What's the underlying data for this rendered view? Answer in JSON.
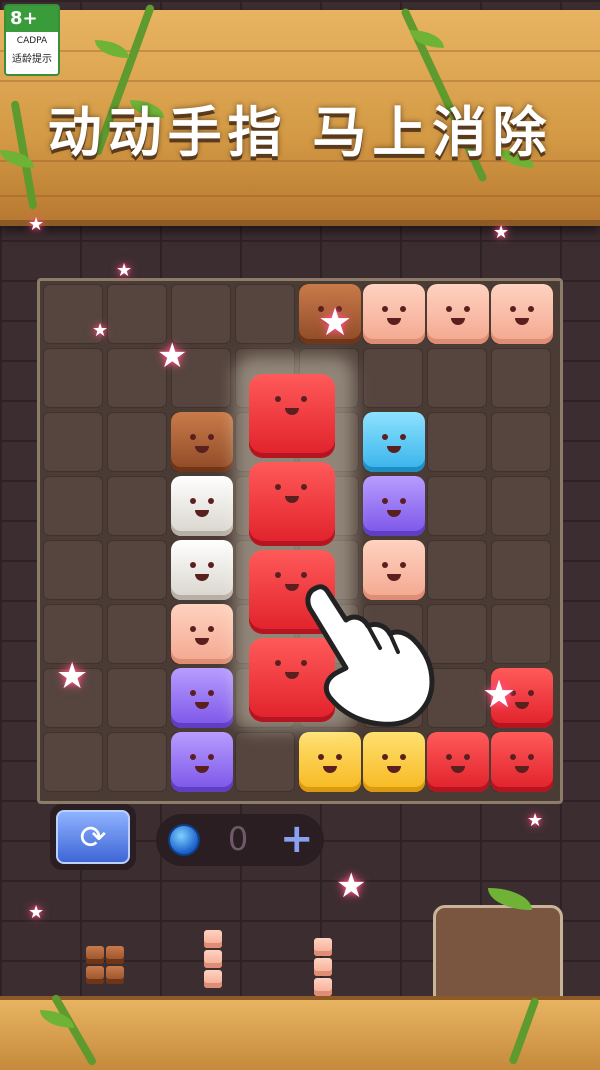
{
  "age_rating": {
    "age": "8+",
    "org": "CADPA",
    "label": "适龄提示"
  },
  "banner": {
    "title": "动动手指 马上消除"
  },
  "board": {
    "cols": 8,
    "rows": 8,
    "blocks": [
      {
        "color": "brown",
        "row": 0,
        "col": 4
      },
      {
        "color": "pink",
        "row": 0,
        "col": 5
      },
      {
        "color": "pink",
        "row": 0,
        "col": 6
      },
      {
        "color": "pink",
        "row": 0,
        "col": 7
      },
      {
        "color": "brown",
        "row": 2,
        "col": 2
      },
      {
        "color": "blue",
        "row": 2,
        "col": 5
      },
      {
        "color": "white",
        "row": 3,
        "col": 2
      },
      {
        "color": "purple",
        "row": 3,
        "col": 5
      },
      {
        "color": "white",
        "row": 4,
        "col": 2
      },
      {
        "color": "pink",
        "row": 4,
        "col": 5
      },
      {
        "color": "pink",
        "row": 5,
        "col": 2
      },
      {
        "color": "purple",
        "row": 6,
        "col": 2
      },
      {
        "color": "red",
        "row": 6,
        "col": 7
      },
      {
        "color": "purple",
        "row": 7,
        "col": 2
      },
      {
        "color": "yellow",
        "row": 7,
        "col": 4
      },
      {
        "color": "yellow",
        "row": 7,
        "col": 5
      },
      {
        "color": "red",
        "row": 7,
        "col": 6
      },
      {
        "color": "red",
        "row": 7,
        "col": 7
      }
    ],
    "dragged_column": {
      "color": "red",
      "count": 4
    }
  },
  "controls": {
    "refresh_icon": "refresh-icon",
    "coin_count": "0",
    "add_symbol": "+"
  }
}
